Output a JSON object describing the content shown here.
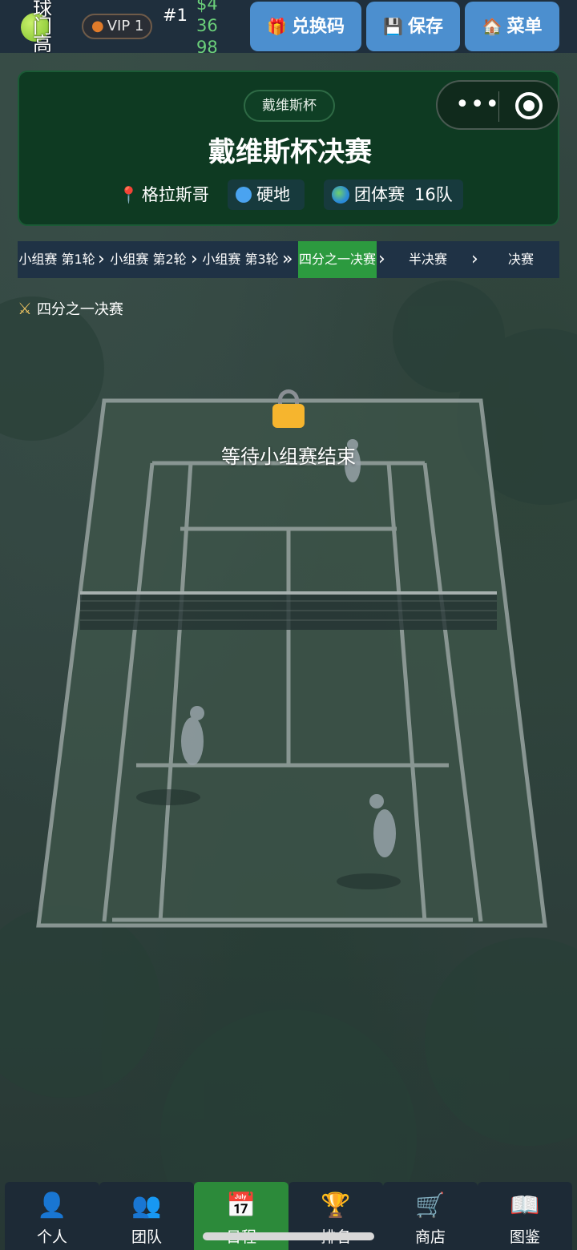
{
  "topbar": {
    "logo_text": "球门高",
    "vip_label": "VIP 1",
    "rank": "#1",
    "money_lines": [
      "$4",
      "36",
      "98"
    ],
    "buttons": {
      "redeem": "兑换码",
      "save": "保存",
      "menu": "菜单"
    }
  },
  "card": {
    "pill": "戴维斯杯",
    "title": "戴维斯杯决赛",
    "location": "格拉斯哥",
    "surface": "硬地",
    "match_type": "团体赛",
    "team_count": "16队"
  },
  "rounds": [
    {
      "label": "小组赛 第1轮",
      "active": false
    },
    {
      "label": "小组赛 第2轮",
      "active": false
    },
    {
      "label": "小组赛 第3轮",
      "active": false
    },
    {
      "label": "四分之一决赛",
      "active": true
    },
    {
      "label": "半决赛",
      "active": false
    },
    {
      "label": "决赛",
      "active": false
    }
  ],
  "round_arrows": [
    "›",
    "›",
    "»",
    "›",
    "›"
  ],
  "section_label": "四分之一决赛",
  "lock_message": "等待小组赛结束",
  "bottom_nav": [
    {
      "label": "个人",
      "icon": "person-icon"
    },
    {
      "label": "团队",
      "icon": "team-icon"
    },
    {
      "label": "日程",
      "icon": "calendar-icon",
      "active": true
    },
    {
      "label": "排名",
      "icon": "trophy-icon"
    },
    {
      "label": "商店",
      "icon": "cart-icon"
    },
    {
      "label": "图鉴",
      "icon": "book-icon"
    }
  ],
  "calendar_icon_text": "17",
  "colors": {
    "accent_blue": "#4c8fcf",
    "active_green": "#2c9a3f",
    "card_green": "#0e3a22",
    "money_green": "#6bd07a",
    "lock_yellow": "#f6b52e"
  }
}
